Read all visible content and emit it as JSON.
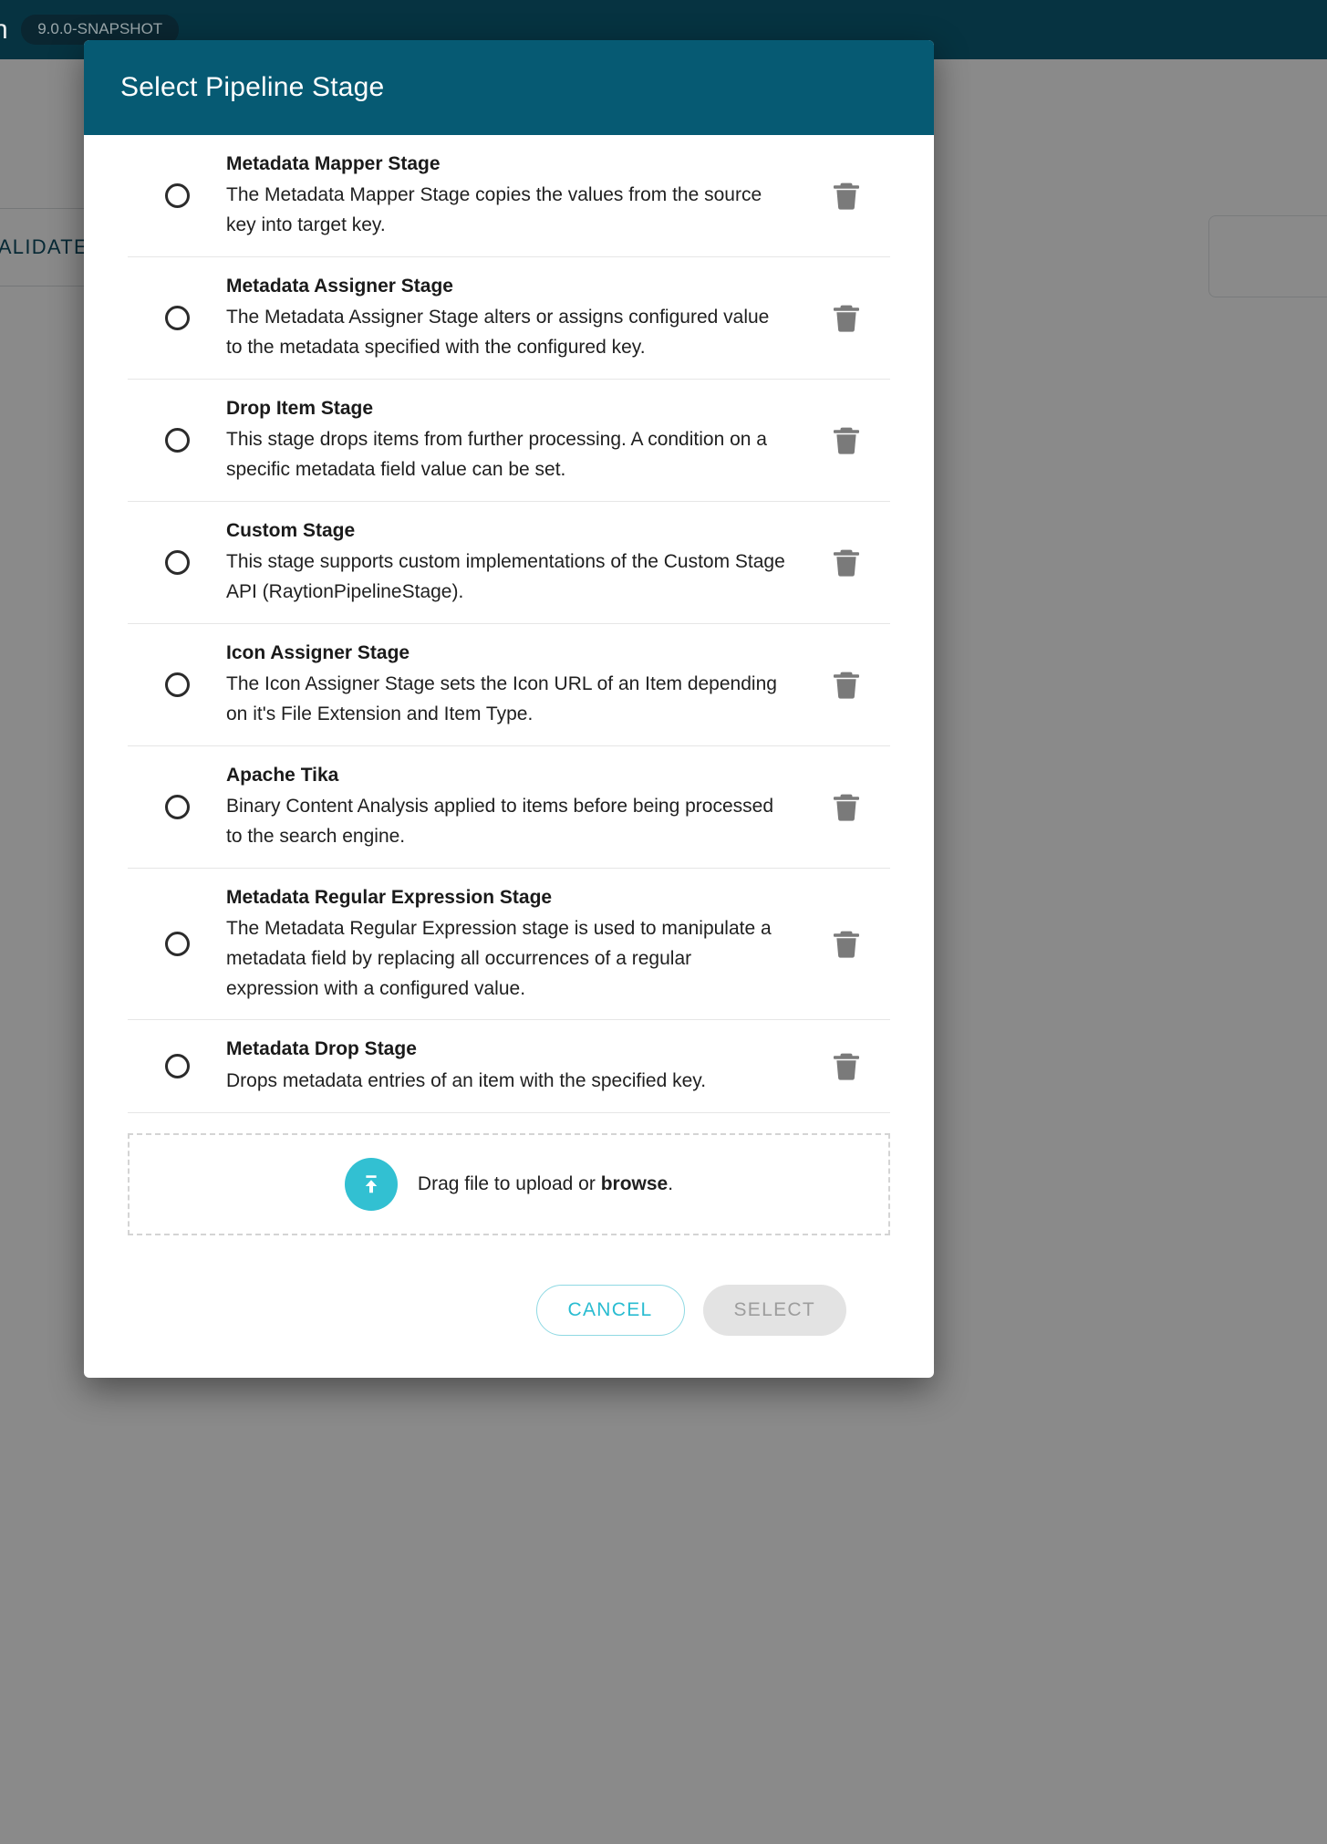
{
  "app": {
    "brand_mark": "n",
    "version_badge": "9.0.0-SNAPSHOT",
    "background_button_label": "ALIDATE"
  },
  "colors": {
    "top_bar": "#063341",
    "dialog_header": "#065a73",
    "accent_cyan": "#32c0d2",
    "cancel_text": "#29bcd1",
    "disabled_button_bg": "#e3e3e3",
    "disabled_button_text": "#9d9d9d",
    "trash_icon": "#7a7a7a",
    "scrim": "rgba(0,0,0,0.46)"
  },
  "dialog": {
    "title": "Select Pipeline Stage",
    "stages": [
      {
        "title": "Metadata Mapper Stage",
        "description": "The Metadata Mapper Stage copies the values from the source key into target key.",
        "radio_name": "radio-metadata-mapper-stage",
        "delete_name": "delete-metadata-mapper-stage"
      },
      {
        "title": "Metadata Assigner Stage",
        "description": "The Metadata Assigner Stage alters or assigns configured value to the metadata specified with the configured key.",
        "radio_name": "radio-metadata-assigner-stage",
        "delete_name": "delete-metadata-assigner-stage"
      },
      {
        "title": "Drop Item Stage",
        "description": "This stage drops items from further processing. A condition on a specific metadata field value can be set.",
        "radio_name": "radio-drop-item-stage",
        "delete_name": "delete-drop-item-stage"
      },
      {
        "title": "Custom Stage",
        "description": "This stage supports custom implementations of the Custom Stage API (RaytionPipelineStage).",
        "radio_name": "radio-custom-stage",
        "delete_name": "delete-custom-stage"
      },
      {
        "title": "Icon Assigner Stage",
        "description": "The Icon Assigner Stage sets the Icon URL of an Item depending on it's File Extension and Item Type.",
        "radio_name": "radio-icon-assigner-stage",
        "delete_name": "delete-icon-assigner-stage"
      },
      {
        "title": "Apache Tika",
        "description": "Binary Content Analysis applied to items before being processed to the search engine.",
        "radio_name": "radio-apache-tika",
        "delete_name": "delete-apache-tika"
      },
      {
        "title": "Metadata Regular Expression Stage",
        "description": "The Metadata Regular Expression stage is used to manipulate a metadata field by replacing all occurrences of a regular expression with a configured value.",
        "radio_name": "radio-metadata-regular-expression-stage",
        "delete_name": "delete-metadata-regular-expression-stage"
      },
      {
        "title": "Metadata Drop Stage",
        "description": "Drops metadata entries of an item with the specified key.",
        "radio_name": "radio-metadata-drop-stage",
        "delete_name": "delete-metadata-drop-stage"
      }
    ],
    "dropzone": {
      "text_before": "Drag file to upload or ",
      "link_label": "browse",
      "text_after": "."
    },
    "footer": {
      "cancel_label": "CANCEL",
      "select_label": "SELECT",
      "select_disabled": true
    }
  },
  "icons": {
    "trash": "trash-icon",
    "upload": "upload-arrow-icon",
    "radio": "radio-unchecked-icon"
  }
}
